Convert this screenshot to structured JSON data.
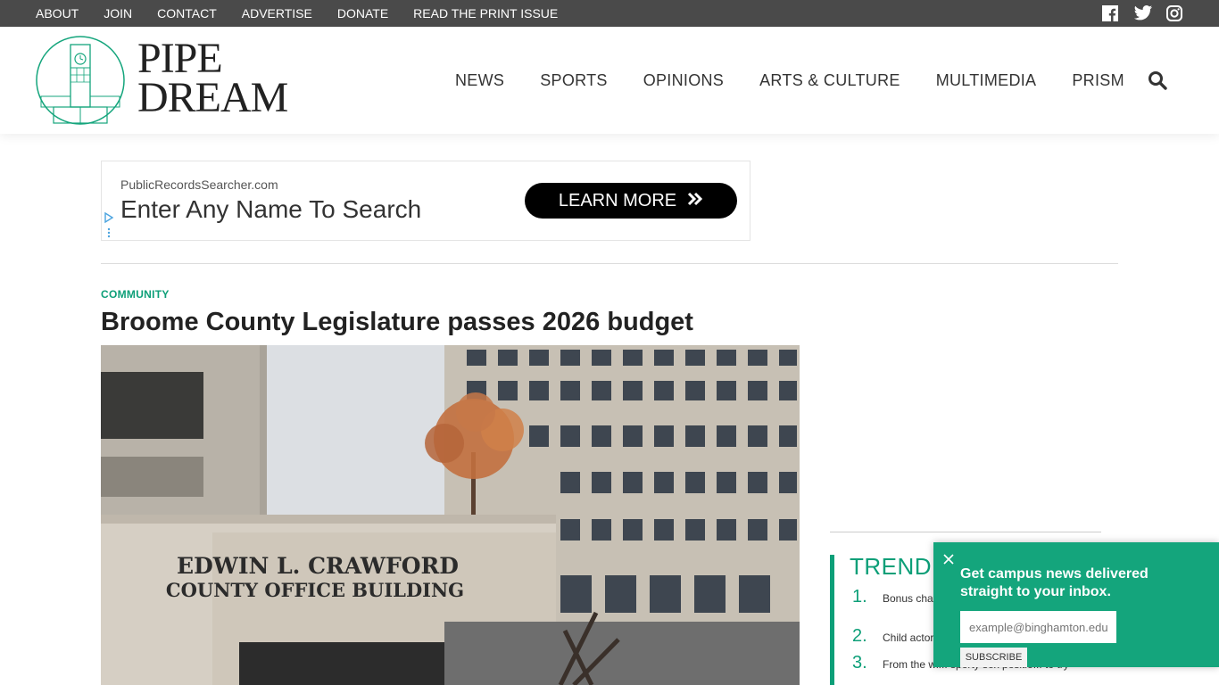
{
  "topbar": {
    "links": [
      "ABOUT",
      "JOIN",
      "CONTACT",
      "ADVERTISE",
      "DONATE",
      "READ THE PRINT ISSUE"
    ],
    "social_icons": [
      "facebook-icon",
      "twitter-icon",
      "instagram-icon"
    ]
  },
  "header": {
    "logo_line1": "PIPE",
    "logo_line2": "DREAM",
    "nav": [
      "NEWS",
      "SPORTS",
      "OPINIONS",
      "ARTS & CULTURE",
      "MULTIMEDIA",
      "PRISM"
    ],
    "search_icon": "search-icon"
  },
  "ad": {
    "domain": "PublicRecordsSearcher.com",
    "headline": "Enter Any Name To Search",
    "cta": "LEARN MORE",
    "cta_icon": "double-chevron-right-icon"
  },
  "article": {
    "category": "COMMUNITY",
    "title": "Broome County Legislature passes 2026 budget",
    "photo_sign_line1": "EDWIN L. CRAWFORD",
    "photo_sign_line2": "COUNTY OFFICE BUILDING"
  },
  "trending": {
    "heading": "TRENDI",
    "items": [
      {
        "num": "1.",
        "text": "Bonus chap... must be tru..."
      },
      {
        "num": "2.",
        "text": "Child actor s..."
      },
      {
        "num": "3.",
        "text": "From the wi... sporty sex positio... to try"
      }
    ]
  },
  "popup": {
    "message": "Get campus news delivered straight to your inbox.",
    "email_placeholder": "example@binghamton.edu",
    "subscribe": "SUBSCRIBE"
  },
  "colors": {
    "accent": "#0d9f78",
    "topbar": "#4a4a4a",
    "popup": "#14a57c"
  }
}
